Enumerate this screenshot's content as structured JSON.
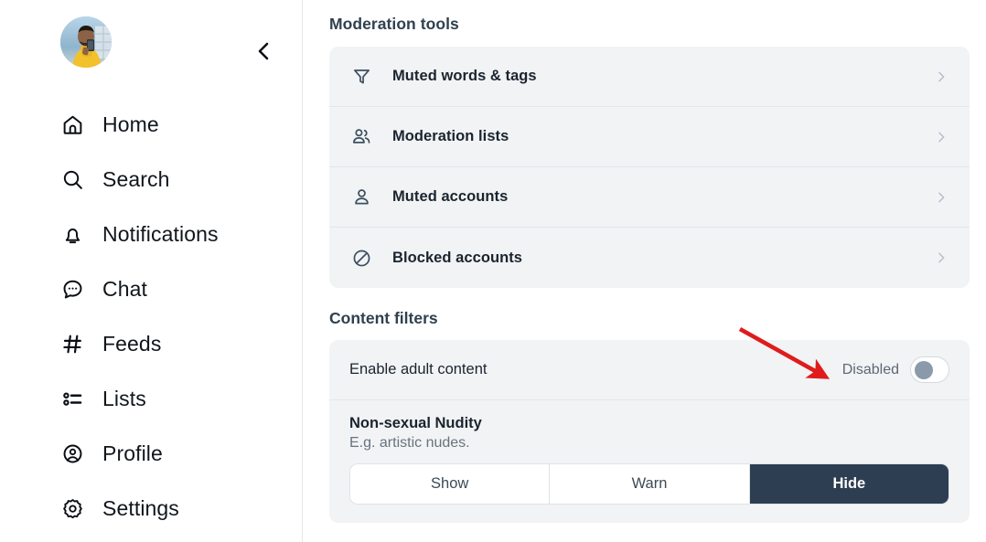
{
  "sidebar": {
    "avatar_alt": "user-avatar",
    "collapse_icon": "chevron-left-icon",
    "items": [
      {
        "label": "Home",
        "icon": "home-icon"
      },
      {
        "label": "Search",
        "icon": "search-icon"
      },
      {
        "label": "Notifications",
        "icon": "bell-icon"
      },
      {
        "label": "Chat",
        "icon": "chat-bubble-icon"
      },
      {
        "label": "Feeds",
        "icon": "hashtag-icon"
      },
      {
        "label": "Lists",
        "icon": "list-icon"
      },
      {
        "label": "Profile",
        "icon": "user-circle-icon"
      },
      {
        "label": "Settings",
        "icon": "gear-icon"
      }
    ]
  },
  "main": {
    "moderation": {
      "heading": "Moderation tools",
      "rows": [
        {
          "label": "Muted words & tags",
          "icon": "funnel-icon",
          "chevron": "chevron-right-icon"
        },
        {
          "label": "Moderation lists",
          "icon": "people-icon",
          "chevron": "chevron-right-icon"
        },
        {
          "label": "Muted accounts",
          "icon": "person-icon",
          "chevron": "chevron-right-icon"
        },
        {
          "label": "Blocked accounts",
          "icon": "prohibition-icon",
          "chevron": "chevron-right-icon"
        }
      ]
    },
    "content_filters": {
      "heading": "Content filters",
      "adult_content": {
        "label": "Enable adult content",
        "state_text": "Disabled",
        "toggle_on": false
      },
      "nudity": {
        "title": "Non-sexual Nudity",
        "description": "E.g. artistic nudes.",
        "options": [
          "Show",
          "Warn",
          "Hide"
        ],
        "selected": "Hide"
      }
    }
  },
  "annotation": {
    "arrow_color": "#e01b1b",
    "arrow_name": "red-pointer-arrow"
  },
  "colors": {
    "card_bg": "#f1f3f5",
    "accent_dark": "#2e3e52",
    "text_primary": "#1b242e",
    "text_muted": "#68737f",
    "divider": "#e4e7ea",
    "arrow_red": "#e01b1b"
  }
}
